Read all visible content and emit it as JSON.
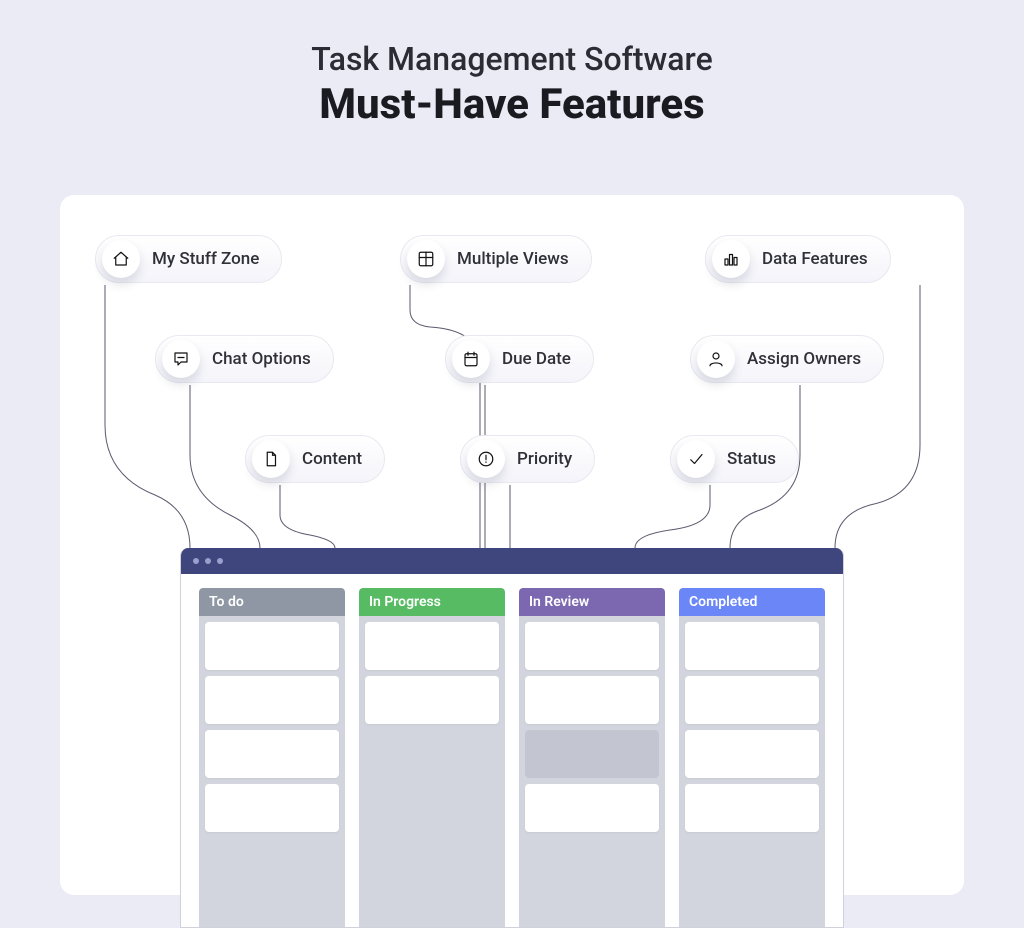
{
  "title": {
    "line1": "Task Management Software",
    "line2": "Must-Have Features"
  },
  "pills": {
    "my_stuff": "My Stuff Zone",
    "chat": "Chat Options",
    "content": "Content",
    "views": "Multiple Views",
    "due": "Due Date",
    "priority": "Priority",
    "data": "Data Features",
    "owners": "Assign Owners",
    "status": "Status"
  },
  "board": {
    "columns": [
      {
        "name": "To do",
        "color": "#8e97a3",
        "cards": 4
      },
      {
        "name": "In Progress",
        "color": "#56bb63",
        "cards": 2
      },
      {
        "name": "In Review",
        "color": "#7b68b0",
        "cards": 4
      },
      {
        "name": "Completed",
        "color": "#6a86f7",
        "cards": 4
      }
    ]
  }
}
